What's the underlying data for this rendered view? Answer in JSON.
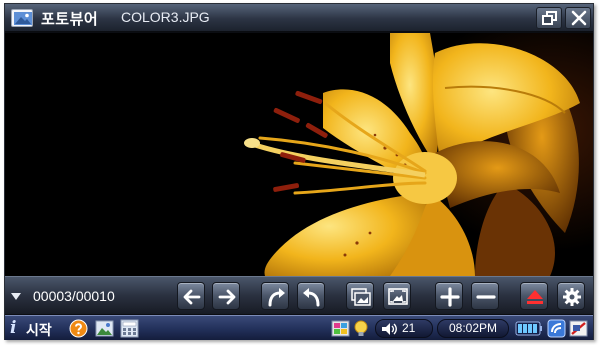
{
  "window": {
    "app_title": "포토뷰어",
    "file_name": "COLOR3.JPG"
  },
  "controls": {
    "page_counter": "00003/00010"
  },
  "taskbar": {
    "start_logo": "i",
    "start_label": "시작",
    "volume": "21",
    "clock": "08:02PM"
  },
  "colors": {
    "title_bar": "#2c3444",
    "control_bar": "#2a3140",
    "taskbar": "#22305a",
    "flower": "#f2b51c"
  },
  "icons": [
    "image-icon",
    "restore-icon",
    "close-icon",
    "menu-arrow-icon",
    "arrow-left-icon",
    "arrow-right-icon",
    "rotate-right-icon",
    "rotate-left-icon",
    "slideshow-icon",
    "fit-screen-icon",
    "zoom-in-icon",
    "zoom-out-icon",
    "eject-icon",
    "gear-icon",
    "help-icon",
    "picture-app-icon",
    "calculator-icon",
    "color-palette-icon",
    "speaker-icon",
    "battery-icon",
    "network-icon",
    "power-icon"
  ]
}
